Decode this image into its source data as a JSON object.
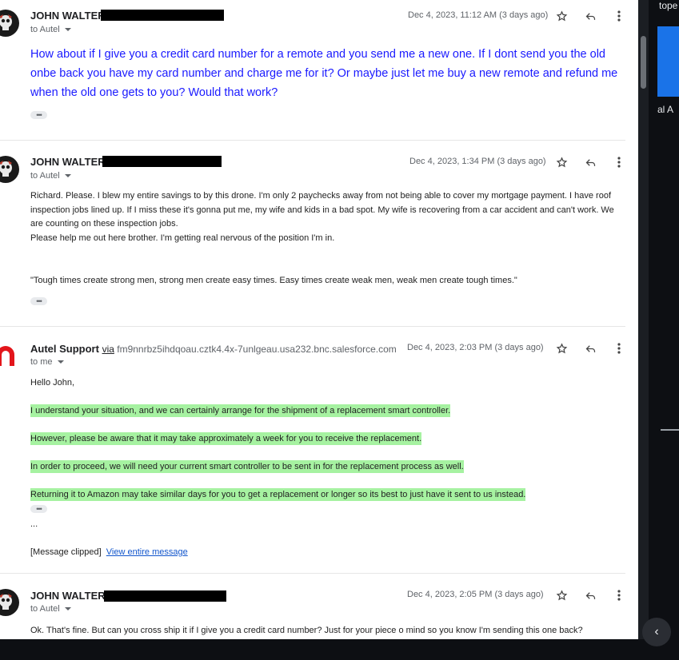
{
  "messages": [
    {
      "sender": "JOHN WALTER",
      "recipient": "to Autel",
      "date": "Dec 4, 2023, 11:12 AM (3 days ago)",
      "body": "How about if I give you a credit card number for a remote and you send me a new one. If I dont send you the old onbe back you have my card number and charge me for it? Or maybe just let me buy a new remote and refund me when the old one gets to you? Would that work?"
    },
    {
      "sender": "JOHN WALTER",
      "recipient": "to Autel",
      "date": "Dec 4, 2023, 1:34 PM (3 days ago)",
      "paragraphs": [
        "Richard. Please. I blew my entire savings to by this drone. I'm only 2 paychecks away from not being able to cover my mortgage payment. I have roof inspection jobs lined up. If I miss these it's gonna put me, my wife and kids in a bad spot. My wife is recovering from a car accident and can't work. We are counting on these inspection jobs.",
        "Please help me out here brother. I'm getting real nervous of the position I'm in.",
        "\"Tough times create strong men, strong men create easy times. Easy times create weak men, weak men create tough times.\""
      ]
    },
    {
      "sender": "Autel Support",
      "via_label": "via",
      "via_address": "fm9nnrbz5ihdqoau.cztk4.4x-7unlgeau.usa232.bnc.salesforce.com",
      "recipient": "to me",
      "date": "Dec 4, 2023, 2:03 PM (3 days ago)",
      "greeting": "Hello John,",
      "highlighted": [
        "I understand your situation, and we can certainly arrange for the shipment of a replacement smart controller.",
        "However, please be aware that it may take approximately a week for you to receive the replacement.",
        "In order to proceed, we will need your current smart controller to be sent in for the replacement process as well.",
        "Returning it to Amazon may take similar days for you to get a replacement or longer so its best to just have it sent to us instead."
      ],
      "trailing_dots": "...",
      "clipped_label": "[Message clipped]",
      "view_entire_link": "View entire message"
    },
    {
      "sender": "JOHN WALTER",
      "recipient": "to Autel",
      "date": "Dec 4, 2023, 2:05 PM (3 days ago)",
      "body": "Ok. That's fine. But can you cross ship it if I give you a credit card number? Just for your piece o mind so you know I'm sending this one back?"
    }
  ],
  "side_panel": {
    "text_top": "tope",
    "text_mid": "al A"
  },
  "icons": {
    "star": "star-icon",
    "reply": "reply-icon",
    "more": "more-vert-icon",
    "collapse": "chevron-left-icon"
  },
  "colors": {
    "blue_text": "#1a1aff",
    "highlight": "#a6f2a1",
    "link": "#1155cc",
    "autel_red": "#e3151b"
  }
}
